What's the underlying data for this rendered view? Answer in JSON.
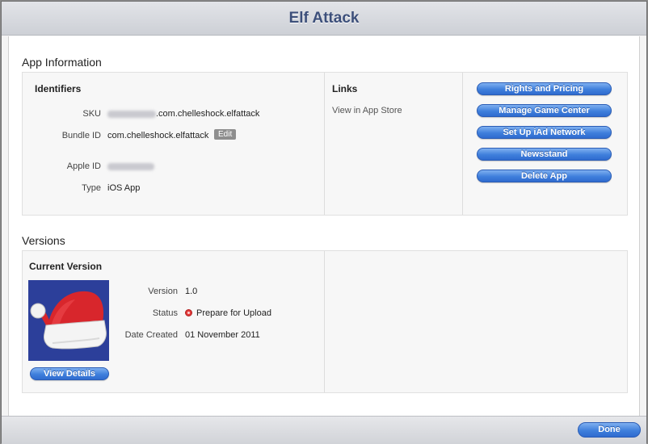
{
  "window": {
    "title": "Elf Attack"
  },
  "app_information": {
    "heading": "App Information",
    "identifiers": {
      "title": "Identifiers",
      "sku_label": "SKU",
      "sku_suffix": ".com.chelleshock.elfattack",
      "bundle_id_label": "Bundle ID",
      "bundle_id_value": "com.chelleshock.elfattack",
      "edit_label": "Edit",
      "apple_id_label": "Apple ID",
      "type_label": "Type",
      "type_value": "iOS App"
    },
    "links": {
      "title": "Links",
      "view_in_app_store": "View in App Store"
    },
    "actions": [
      "Rights and Pricing",
      "Manage Game Center",
      "Set Up iAd Network",
      "Newsstand",
      "Delete App"
    ]
  },
  "versions": {
    "heading": "Versions",
    "current_version": {
      "title": "Current Version",
      "version_label": "Version",
      "version_value": "1.0",
      "status_label": "Status",
      "status_value": "Prepare for Upload",
      "date_created_label": "Date Created",
      "date_created_value": "01 November 2011",
      "view_details_label": "View Details"
    }
  },
  "footer": {
    "done_label": "Done"
  },
  "icons": {
    "app_icon": "santa-hat-icon",
    "status_icon": "red-status-icon"
  },
  "colors": {
    "title_text": "#3c4f7a",
    "button_blue": "#3f7fdc",
    "status_red": "#e23b3b",
    "app_icon_bg": "#2c3f9a"
  }
}
